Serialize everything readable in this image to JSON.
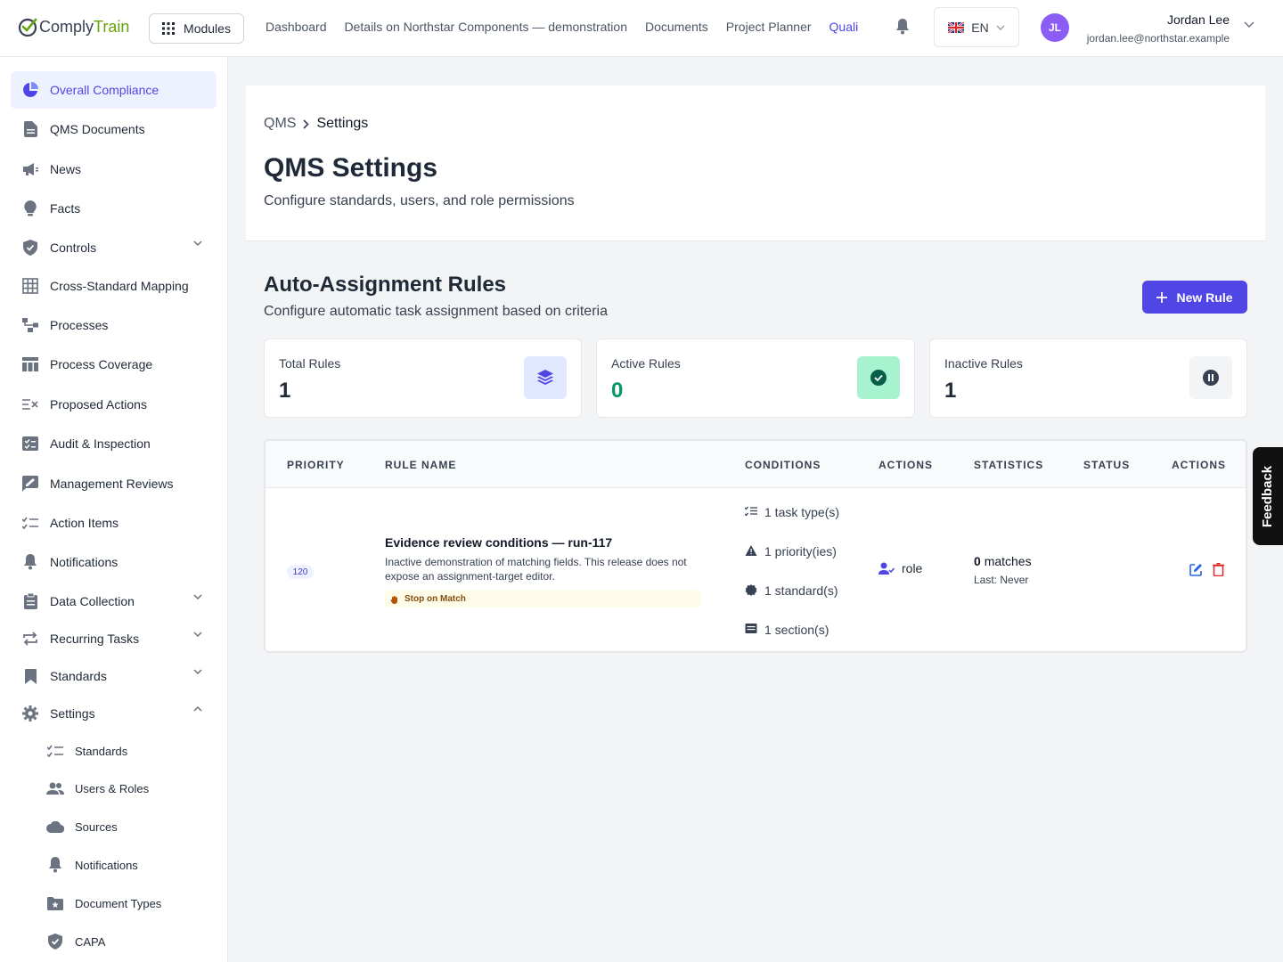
{
  "app": {
    "logo_part1": "Comply",
    "logo_part2": "Train",
    "modules_label": "Modules",
    "topnav": [
      "Dashboard",
      "Details on Northstar Components — demonstration",
      "Documents",
      "Project Planner",
      "Quali"
    ],
    "language": "EN",
    "user": {
      "initials": "JL",
      "name": "Jordan Lee",
      "email": "jordan.lee@northstar.example"
    }
  },
  "sidebar": {
    "items": [
      {
        "label": "Overall Compliance",
        "icon": "pie-chart-icon",
        "active": true
      },
      {
        "label": "QMS Documents",
        "icon": "document-icon"
      },
      {
        "label": "News",
        "icon": "megaphone-icon"
      },
      {
        "label": "Facts",
        "icon": "lightbulb-icon"
      },
      {
        "label": "Controls",
        "icon": "shield-check-icon",
        "expandable": true
      },
      {
        "label": "Cross-Standard Mapping",
        "icon": "grid-icon"
      },
      {
        "label": "Processes",
        "icon": "flow-icon"
      },
      {
        "label": "Process Coverage",
        "icon": "table-icon"
      },
      {
        "label": "Proposed Actions",
        "icon": "list-x-icon"
      },
      {
        "label": "Audit & Inspection",
        "icon": "checklist-icon"
      },
      {
        "label": "Management Reviews",
        "icon": "review-icon"
      },
      {
        "label": "Action Items",
        "icon": "list-check-icon"
      },
      {
        "label": "Notifications",
        "icon": "bell-icon"
      },
      {
        "label": "Data Collection",
        "icon": "clipboard-icon",
        "expandable": true
      },
      {
        "label": "Recurring Tasks",
        "icon": "repeat-icon",
        "expandable": true
      },
      {
        "label": "Standards",
        "icon": "bookmark-icon",
        "expandable": true
      },
      {
        "label": "Settings",
        "icon": "gear-icon",
        "expanded": true
      }
    ],
    "sub_items": [
      {
        "label": "Standards",
        "icon": "list-check-icon"
      },
      {
        "label": "Users & Roles",
        "icon": "users-icon"
      },
      {
        "label": "Sources",
        "icon": "cloud-icon"
      },
      {
        "label": "Notifications",
        "icon": "bell-icon"
      },
      {
        "label": "Document Types",
        "icon": "folder-star-icon"
      },
      {
        "label": "CAPA",
        "icon": "shield-check-icon"
      }
    ]
  },
  "header": {
    "breadcrumb": [
      "QMS",
      "Settings"
    ],
    "title": "QMS Settings",
    "subtitle": "Configure standards, users, and role permissions"
  },
  "rules_section": {
    "title": "Auto-Assignment Rules",
    "subtitle": "Configure automatic task assignment based on criteria",
    "new_button": "New Rule",
    "stats": [
      {
        "label": "Total Rules",
        "value": "1",
        "icon": "layers-icon",
        "color": "#4f46e5"
      },
      {
        "label": "Active Rules",
        "value": "0",
        "icon": "check-circle-icon",
        "color": "#059669"
      },
      {
        "label": "Inactive Rules",
        "value": "1",
        "icon": "pause-circle-icon",
        "color": "#374151"
      }
    ],
    "columns": [
      "Priority",
      "Rule Name",
      "Conditions",
      "Actions",
      "Statistics",
      "Status",
      "Actions"
    ],
    "rows": [
      {
        "priority": "120",
        "name": "Evidence review conditions — run-117",
        "description": "Inactive demonstration of matching fields. This release does not expose an assignment-target editor.",
        "tag": "Stop on Match",
        "conditions": [
          "1 task type(s)",
          "1 priority(ies)",
          "1 standard(s)",
          "1 section(s)"
        ],
        "action": "role",
        "matches_count": "0",
        "matches_label": "matches",
        "last": "Last: Never"
      }
    ]
  },
  "feedback": "Feedback"
}
